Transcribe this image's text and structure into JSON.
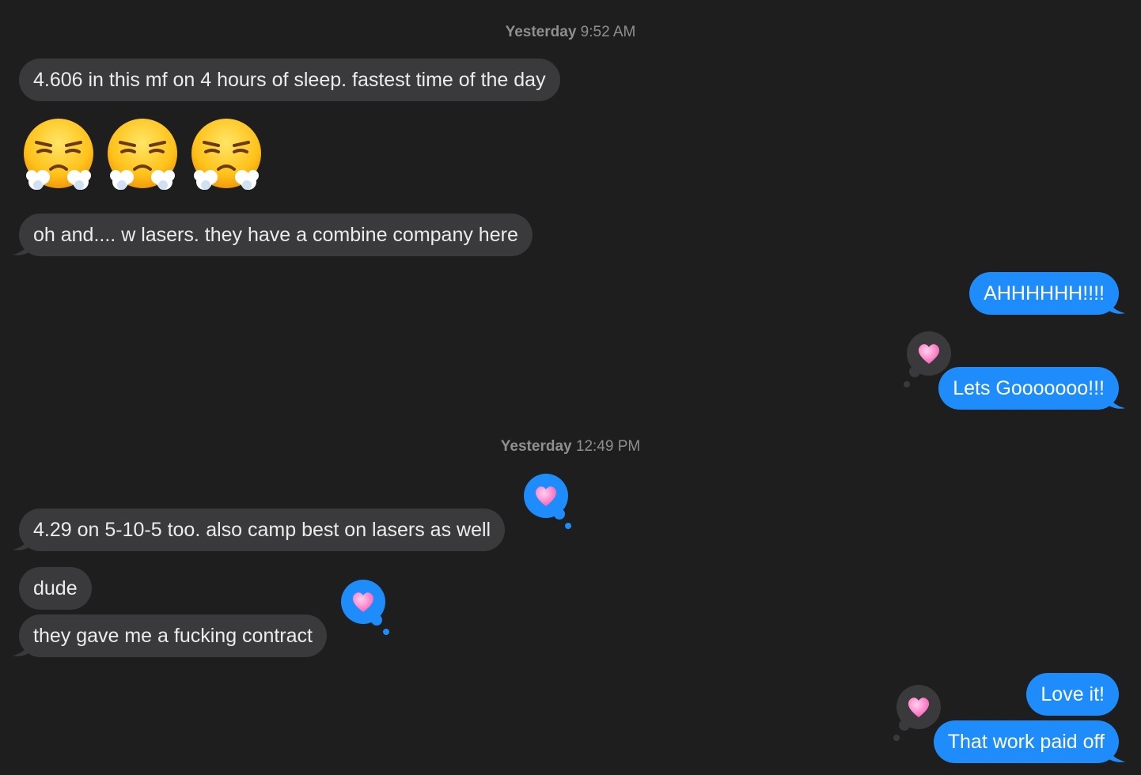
{
  "timestamps": [
    {
      "day": "Yesterday",
      "time": "9:52 AM"
    },
    {
      "day": "Yesterday",
      "time": "12:49 PM"
    }
  ],
  "messages": {
    "m1": "4.606 in this mf on 4 hours of sleep. fastest time of the day",
    "m2_emoji": [
      "face-with-steam-from-nose",
      "face-with-steam-from-nose",
      "face-with-steam-from-nose"
    ],
    "m3": "oh and.... w lasers. they have a combine company here",
    "m4": "AHHHHHH!!!!",
    "m5": "Lets Gooooooo!!!",
    "m6": "4.29 on 5-10-5 too. also camp best on lasers as well",
    "m7": "dude",
    "m8": "they gave me a fucking contract",
    "m9": "Love it!",
    "m10": "That work paid off"
  },
  "reactions": {
    "icon": "heart-icon",
    "sent_style": "gray",
    "received_style": "blue"
  },
  "colors": {
    "background": "#1e1e1e",
    "incoming_bubble": "#3a3a3c",
    "outgoing_bubble": "#1e8cfb",
    "timestamp_text": "#8e8e93",
    "heart": "#ff8fd0"
  }
}
